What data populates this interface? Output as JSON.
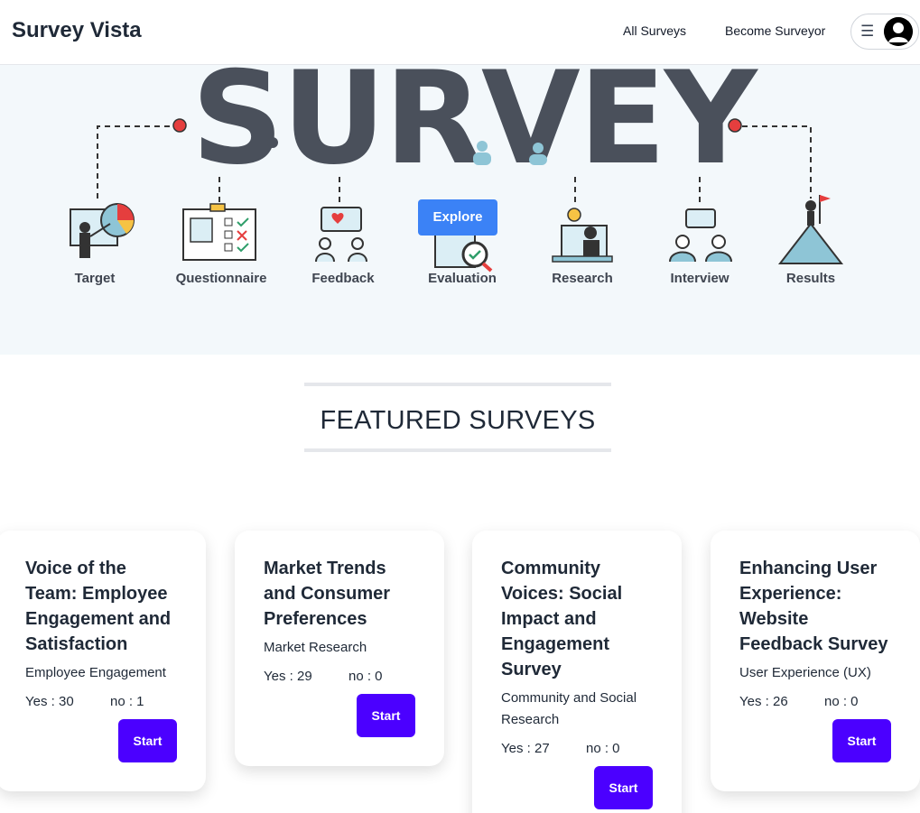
{
  "brand": "Survey Vista",
  "nav": {
    "all_surveys": "All Surveys",
    "become_surveyor": "Become Surveyor",
    "menu_icon": "hamburger-menu-icon",
    "avatar_icon": "user-avatar-icon"
  },
  "hero": {
    "headline": "SURVEY",
    "steps": [
      "Target",
      "Questionnaire",
      "Feedback",
      "Evaluation",
      "Research",
      "Interview",
      "Results"
    ],
    "explore_label": "Explore"
  },
  "featured_title": "FEATURED SURVEYS",
  "cards": [
    {
      "title": "Voice of the Team: Employee Engagement and Satisfaction",
      "category": "Employee Engagement",
      "yes": "Yes : 30",
      "no": "no : 1",
      "button": "Start"
    },
    {
      "title": "Market Trends and Consumer Preferences",
      "category": "Market Research",
      "yes": "Yes : 29",
      "no": "no : 0",
      "button": "Start"
    },
    {
      "title": "Community Voices: Social Impact and Engagement Survey",
      "category": "Community and Social Research",
      "yes": "Yes : 27",
      "no": "no : 0",
      "button": "Start"
    },
    {
      "title": "Enhancing User Experience: Website Feedback Survey",
      "category": "User Experience (UX)",
      "yes": "Yes : 26",
      "no": "no : 0",
      "button": "Start"
    }
  ],
  "colors": {
    "primary_button": "#4b00ff",
    "explore_button": "#3b82f6",
    "hero_bg": "#f3f8fb",
    "hero_text": "#4a505b",
    "accent_red": "#e53e3e"
  }
}
